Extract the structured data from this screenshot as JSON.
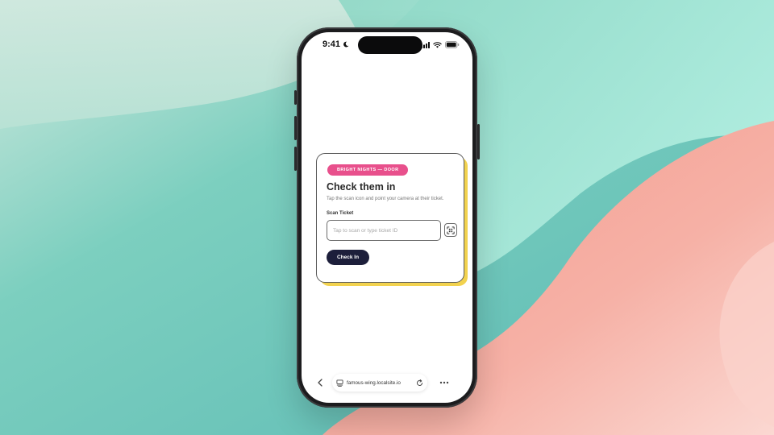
{
  "colors": {
    "badge_bg": "#e8508c",
    "button_bg": "#1d1f3b",
    "card_shadow": "#f2d24e",
    "bg_teal": "#7fd3c5",
    "bg_coral": "#f4a69a"
  },
  "status_bar": {
    "time": "9:41",
    "icons": [
      "moon-icon",
      "signal-icon",
      "wifi-icon",
      "battery-icon"
    ]
  },
  "card": {
    "badge": "BRIGHT NIGHTS — DOOR",
    "title": "Check them in",
    "subtitle": "Tap the scan icon and point your camera at their ticket.",
    "field_label": "Scan Ticket",
    "input_value": "",
    "input_placeholder": "Tap to scan or type ticket ID",
    "scan_icon": "qr-scan-icon",
    "button_label": "Check In"
  },
  "browser": {
    "url": "famous-wing.localsite.io",
    "icons": [
      "chevron-left-icon",
      "tabs-icon",
      "reload-icon",
      "more-icon"
    ]
  }
}
